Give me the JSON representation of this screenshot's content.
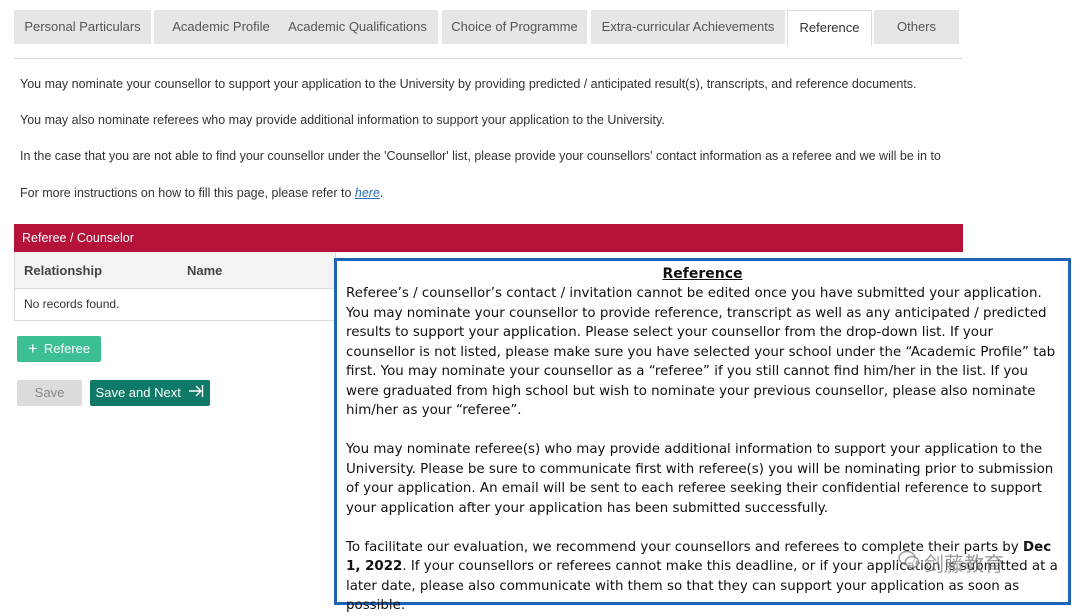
{
  "tabs": [
    {
      "label": "Personal Particulars",
      "active": false
    },
    {
      "label": "Academic Profile",
      "active": false
    },
    {
      "label": "Academic Qualifications",
      "active": false
    },
    {
      "label": "Choice of Programme",
      "active": false
    },
    {
      "label": "Extra-curricular Achievements",
      "active": false
    },
    {
      "label": "Reference",
      "active": true
    },
    {
      "label": "Others",
      "active": false
    }
  ],
  "intro": {
    "p1": "You may nominate your counsellor to support your application to the University by providing predicted / anticipated result(s), transcripts, and reference documents.",
    "p2": "You may also nominate referees who may provide additional information to support your application to the University.",
    "p3": "In the case that you are not able to find your counsellor under the 'Counsellor' list, please provide your counsellors' contact information as a referee and we will be in to",
    "p4_prefix": "For more instructions on how to fill this page, please refer to ",
    "p4_link": "here",
    "p4_suffix": "."
  },
  "panel": {
    "title": "Referee / Counselor",
    "columns": [
      "Relationship",
      "Name"
    ],
    "empty_text": "No records found."
  },
  "buttons": {
    "add_referee": "Referee",
    "save": "Save",
    "save_next": "Save and Next"
  },
  "callout": {
    "title": "Reference",
    "p1": "Referee’s / counsellor’s contact / invitation cannot be edited once you have submitted your application. You may nominate your counsellor to provide reference, transcript as well as any anticipated / predicted results to support your application. Please select your counsellor from the drop-down list. If your counsellor is not listed, please make sure you have selected your school under the “Academic Profile” tab first. You may nominate your counsellor as a “referee” if you still cannot find him/her in the list. If you were graduated from high school but wish to nominate your previous counsellor, please also nominate him/her as your “referee”.",
    "p2": "You may nominate referee(s) who may provide additional information to support your application to the University. Please be sure to communicate first with referee(s) you will be nominating prior to submission of your application.  An email will be sent to each referee seeking their confidential reference to support your application after your application has been submitted successfully.",
    "p3_prefix": "To facilitate our evaluation, we recommend your counsellors and referees to complete their parts by ",
    "p3_bold": "Dec 1, 2022",
    "p3_suffix": ". If your counsellors or referees cannot make this deadline, or if your application is submitted at a later date, please also communicate with them so that they can support your application as soon as possible."
  },
  "watermark": "剑藤教育",
  "colors": {
    "panel_header": "#b5123a",
    "add_button": "#3dbf95",
    "save_next_button": "#0f7a68",
    "callout_border": "#1f63b8",
    "link": "#2a6ebb"
  }
}
